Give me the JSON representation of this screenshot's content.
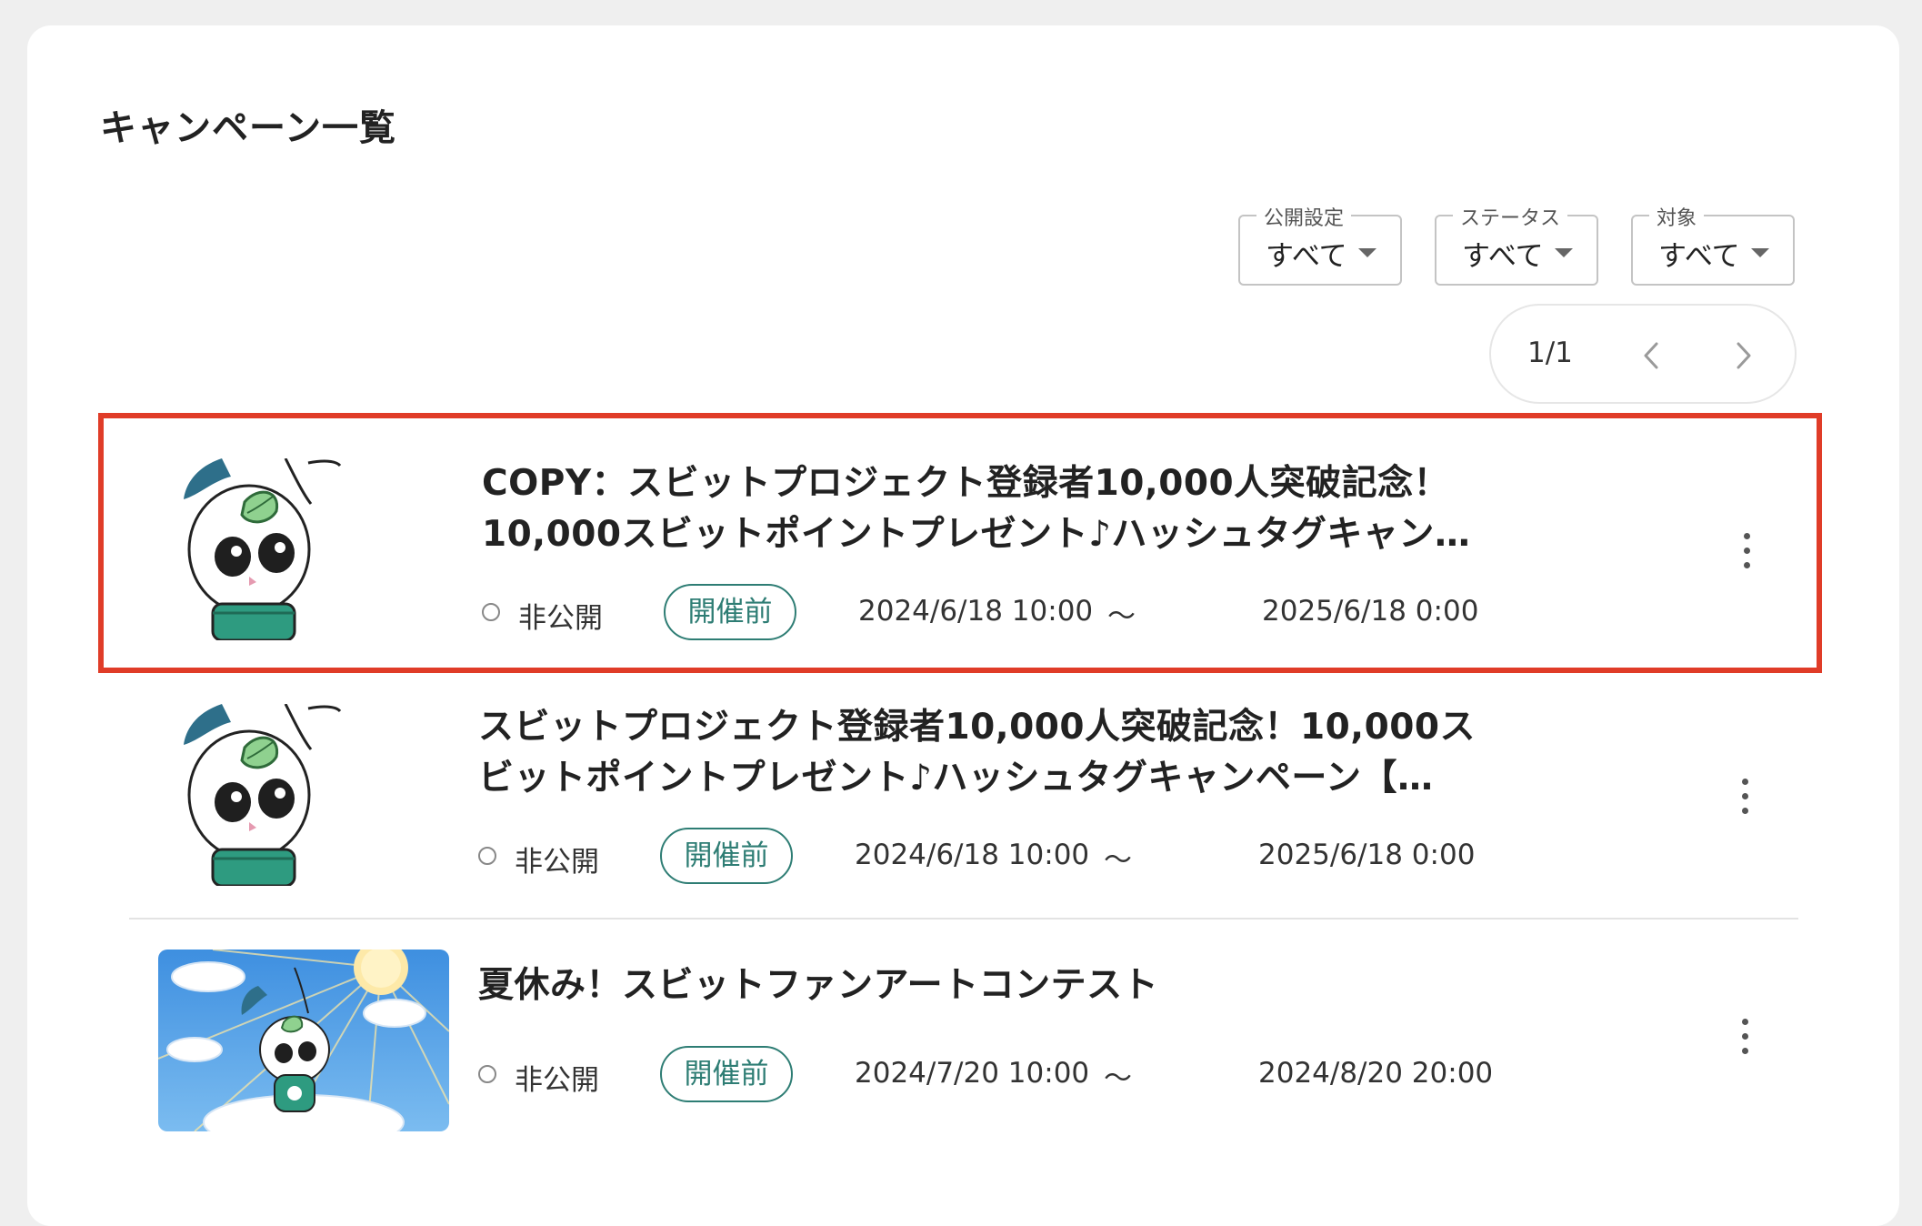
{
  "page": {
    "title": "キャンペーン一覧"
  },
  "filters": [
    {
      "label": "公開設定",
      "value": "すべて"
    },
    {
      "label": "ステータス",
      "value": "すべて"
    },
    {
      "label": "対象",
      "value": "すべて"
    }
  ],
  "pager": {
    "count": "1/1",
    "prev_icon": "chevron-left-icon",
    "next_icon": "chevron-right-icon"
  },
  "campaigns": [
    {
      "title_line1": "COPY：スビットプロジェクト登録者10,000人突破記念！",
      "title_line2": "10,000スビットポイントプレゼント♪ハッシュタグキャン…",
      "visibility": "非公開",
      "status": "開催前",
      "start": "2024/6/18 10:00",
      "separator": "〜",
      "end": "2025/6/18 0:00",
      "thumbnail": "rabbit-mascot",
      "highlighted": true
    },
    {
      "title_line1": "スビットプロジェクト登録者10,000人突破記念！10,000ス",
      "title_line2": "ビットポイントプレゼント♪ハッシュタグキャンペーン【…",
      "visibility": "非公開",
      "status": "開催前",
      "start": "2024/6/18 10:00",
      "separator": "〜",
      "end": "2025/6/18 0:00",
      "thumbnail": "rabbit-mascot",
      "highlighted": false
    },
    {
      "title_line1": "夏休み！スビットファンアートコンテスト",
      "visibility": "非公開",
      "status": "開催前",
      "start": "2024/7/20 10:00",
      "separator": "〜",
      "end": "2024/8/20 20:00",
      "thumbnail": "rabbit-on-cloud-sky",
      "highlighted": false
    }
  ],
  "colors": {
    "accent": "#2e7d74",
    "highlight_border": "#e03c28",
    "mascot_teal": "#2e6f8a",
    "leaf_green": "#8fd18f",
    "sky_blue": "#5aa6e8"
  }
}
